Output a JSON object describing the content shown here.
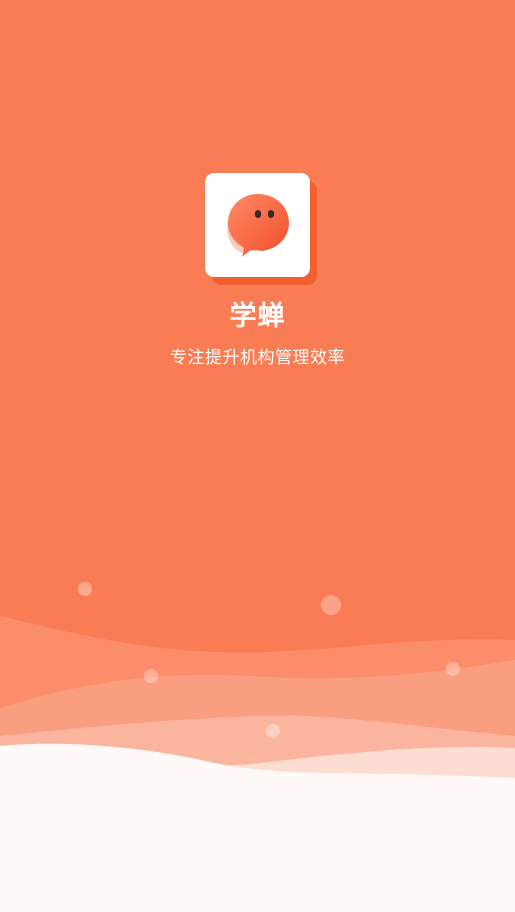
{
  "app": {
    "name": "学蝉",
    "tagline": "专注提升机构管理效率"
  },
  "logo": {
    "icon": "speech-bubble-mascot-icon"
  },
  "colors": {
    "background": "#FA7C55",
    "logo_shadow": "#F0612F",
    "logo_card": "#FFFFFF",
    "text": "#FFFFFF",
    "bottom": "#FFF9F7"
  }
}
